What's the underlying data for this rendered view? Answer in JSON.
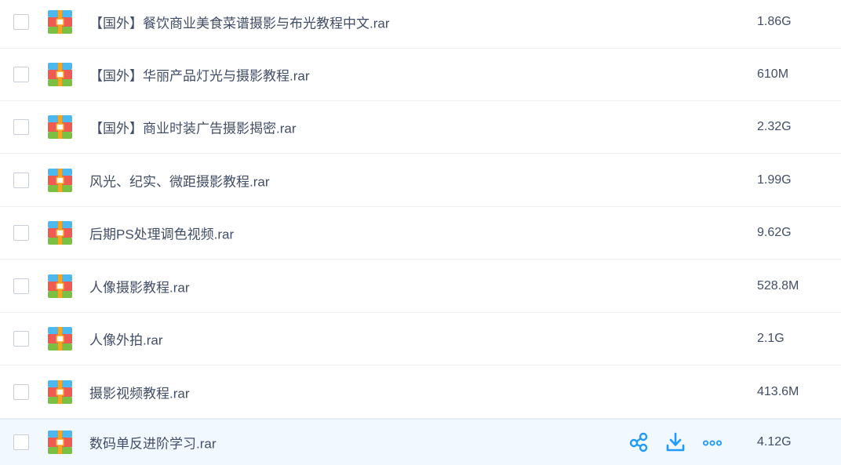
{
  "file_list": {
    "accent_color": "#1f9bff",
    "file_icon": "rar-archive-icon",
    "rows": [
      {
        "name": "【国外】餐饮商业美食菜谱摄影与布光教程中文.rar",
        "size": "1.86G"
      },
      {
        "name": "【国外】华丽产品灯光与摄影教程.rar",
        "size": "610M"
      },
      {
        "name": "【国外】商业时装广告摄影揭密.rar",
        "size": "2.32G"
      },
      {
        "name": "风光、纪实、微距摄影教程.rar",
        "size": "1.99G"
      },
      {
        "name": "后期PS处理调色视频.rar",
        "size": "9.62G"
      },
      {
        "name": "人像摄影教程.rar",
        "size": "528.8M"
      },
      {
        "name": "人像外拍.rar",
        "size": "2.1G"
      },
      {
        "name": "摄影视频教程.rar",
        "size": "413.6M"
      },
      {
        "name": "数码单反进阶学习.rar",
        "size": "4.12G"
      }
    ],
    "hover_row_actions": [
      "share-icon",
      "download-icon",
      "more-icon"
    ]
  }
}
